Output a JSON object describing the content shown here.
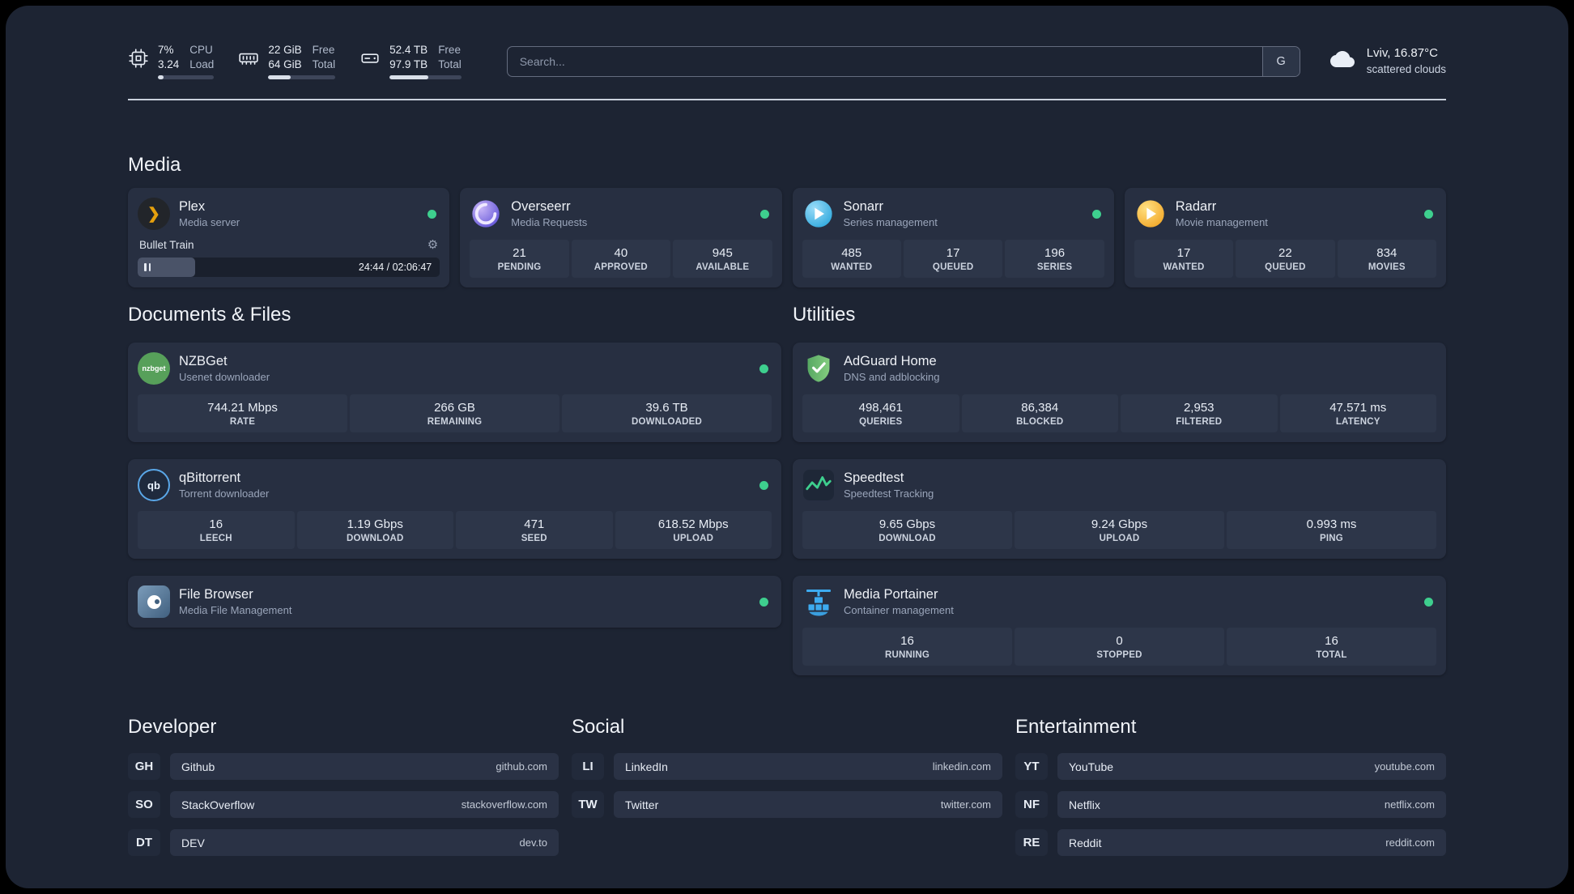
{
  "topbar": {
    "cpu": {
      "icon": "cpu-chip-icon",
      "values": [
        "7%",
        "3.24"
      ],
      "labels": [
        "CPU",
        "Load"
      ],
      "progress_pct": 10
    },
    "ram": {
      "icon": "memory-icon",
      "values": [
        "22 GiB",
        "64 GiB"
      ],
      "labels": [
        "Free",
        "Total"
      ],
      "progress_pct": 34
    },
    "disk": {
      "icon": "hard-drive-icon",
      "values": [
        "52.4 TB",
        "97.9 TB"
      ],
      "labels": [
        "Free",
        "Total"
      ],
      "progress_pct": 54
    },
    "search": {
      "placeholder": "Search...",
      "engine_button": "G"
    },
    "weather": {
      "icon": "cloud-icon",
      "location": "Lviv, 16.87°C",
      "condition": "scattered clouds"
    }
  },
  "media": {
    "title": "Media",
    "plex": {
      "name": "Plex",
      "subtitle": "Media server",
      "online": true,
      "player": {
        "title": "Bullet Train",
        "time": "24:44 / 02:06:47",
        "progress_pct": 19
      }
    },
    "overseerr": {
      "name": "Overseerr",
      "subtitle": "Media Requests",
      "online": true,
      "stats": [
        {
          "value": "21",
          "label": "PENDING"
        },
        {
          "value": "40",
          "label": "APPROVED"
        },
        {
          "value": "945",
          "label": "AVAILABLE"
        }
      ]
    },
    "sonarr": {
      "name": "Sonarr",
      "subtitle": "Series management",
      "online": true,
      "stats": [
        {
          "value": "485",
          "label": "WANTED"
        },
        {
          "value": "17",
          "label": "QUEUED"
        },
        {
          "value": "196",
          "label": "SERIES"
        }
      ]
    },
    "radarr": {
      "name": "Radarr",
      "subtitle": "Movie management",
      "online": true,
      "stats": [
        {
          "value": "17",
          "label": "WANTED"
        },
        {
          "value": "22",
          "label": "QUEUED"
        },
        {
          "value": "834",
          "label": "MOVIES"
        }
      ]
    }
  },
  "documents": {
    "title": "Documents & Files",
    "nzbget": {
      "name": "NZBGet",
      "subtitle": "Usenet downloader",
      "online": true,
      "stats": [
        {
          "value": "744.21 Mbps",
          "label": "RATE"
        },
        {
          "value": "266 GB",
          "label": "REMAINING"
        },
        {
          "value": "39.6 TB",
          "label": "DOWNLOADED"
        }
      ]
    },
    "qbittorrent": {
      "name": "qBittorrent",
      "subtitle": "Torrent downloader",
      "online": true,
      "stats": [
        {
          "value": "16",
          "label": "LEECH"
        },
        {
          "value": "1.19 Gbps",
          "label": "DOWNLOAD"
        },
        {
          "value": "471",
          "label": "SEED"
        },
        {
          "value": "618.52 Mbps",
          "label": "UPLOAD"
        }
      ]
    },
    "filebrowser": {
      "name": "File Browser",
      "subtitle": "Media File Management",
      "online": true
    }
  },
  "utilities": {
    "title": "Utilities",
    "adguard": {
      "name": "AdGuard Home",
      "subtitle": "DNS and adblocking",
      "stats": [
        {
          "value": "498,461",
          "label": "QUERIES"
        },
        {
          "value": "86,384",
          "label": "BLOCKED"
        },
        {
          "value": "2,953",
          "label": "FILTERED"
        },
        {
          "value": "47.571 ms",
          "label": "LATENCY"
        }
      ]
    },
    "speedtest": {
      "name": "Speedtest",
      "subtitle": "Speedtest Tracking",
      "stats": [
        {
          "value": "9.65 Gbps",
          "label": "DOWNLOAD"
        },
        {
          "value": "9.24 Gbps",
          "label": "UPLOAD"
        },
        {
          "value": "0.993 ms",
          "label": "PING"
        }
      ]
    },
    "portainer": {
      "name": "Media Portainer",
      "subtitle": "Container management",
      "online": true,
      "stats": [
        {
          "value": "16",
          "label": "RUNNING"
        },
        {
          "value": "0",
          "label": "STOPPED"
        },
        {
          "value": "16",
          "label": "TOTAL"
        }
      ]
    }
  },
  "bookmarks": {
    "developer": {
      "title": "Developer",
      "items": [
        {
          "abbr": "GH",
          "name": "Github",
          "url": "github.com"
        },
        {
          "abbr": "SO",
          "name": "StackOverflow",
          "url": "stackoverflow.com"
        },
        {
          "abbr": "DT",
          "name": "DEV",
          "url": "dev.to"
        }
      ]
    },
    "social": {
      "title": "Social",
      "items": [
        {
          "abbr": "LI",
          "name": "LinkedIn",
          "url": "linkedin.com"
        },
        {
          "abbr": "TW",
          "name": "Twitter",
          "url": "twitter.com"
        }
      ]
    },
    "entertainment": {
      "title": "Entertainment",
      "items": [
        {
          "abbr": "YT",
          "name": "YouTube",
          "url": "youtube.com"
        },
        {
          "abbr": "NF",
          "name": "Netflix",
          "url": "netflix.com"
        },
        {
          "abbr": "RE",
          "name": "Reddit",
          "url": "reddit.com"
        }
      ]
    }
  },
  "icons": {
    "gear": "⚙",
    "plex_chevron": "❯",
    "nzbget_label": "nzbget",
    "qbittorrent_label": "qb"
  },
  "colors": {
    "background": "#1d2433",
    "card": "#272f41",
    "stat_box": "#2d3649",
    "status_online": "#3ecf8e",
    "plex_amber": "#e5a00d",
    "sonarr_blue": "#35c5f4",
    "radarr_amber": "#f7a823",
    "adguard_green": "#6abf69",
    "portainer_blue": "#3dabf0",
    "speedtest_green": "#3ecf8e",
    "nzbget_green": "#57a05a",
    "qbittorrent_blue": "#5aa7e8",
    "filebrowser_blue": "#5c7f9f",
    "overseerr_purple": "#5a51d6"
  }
}
